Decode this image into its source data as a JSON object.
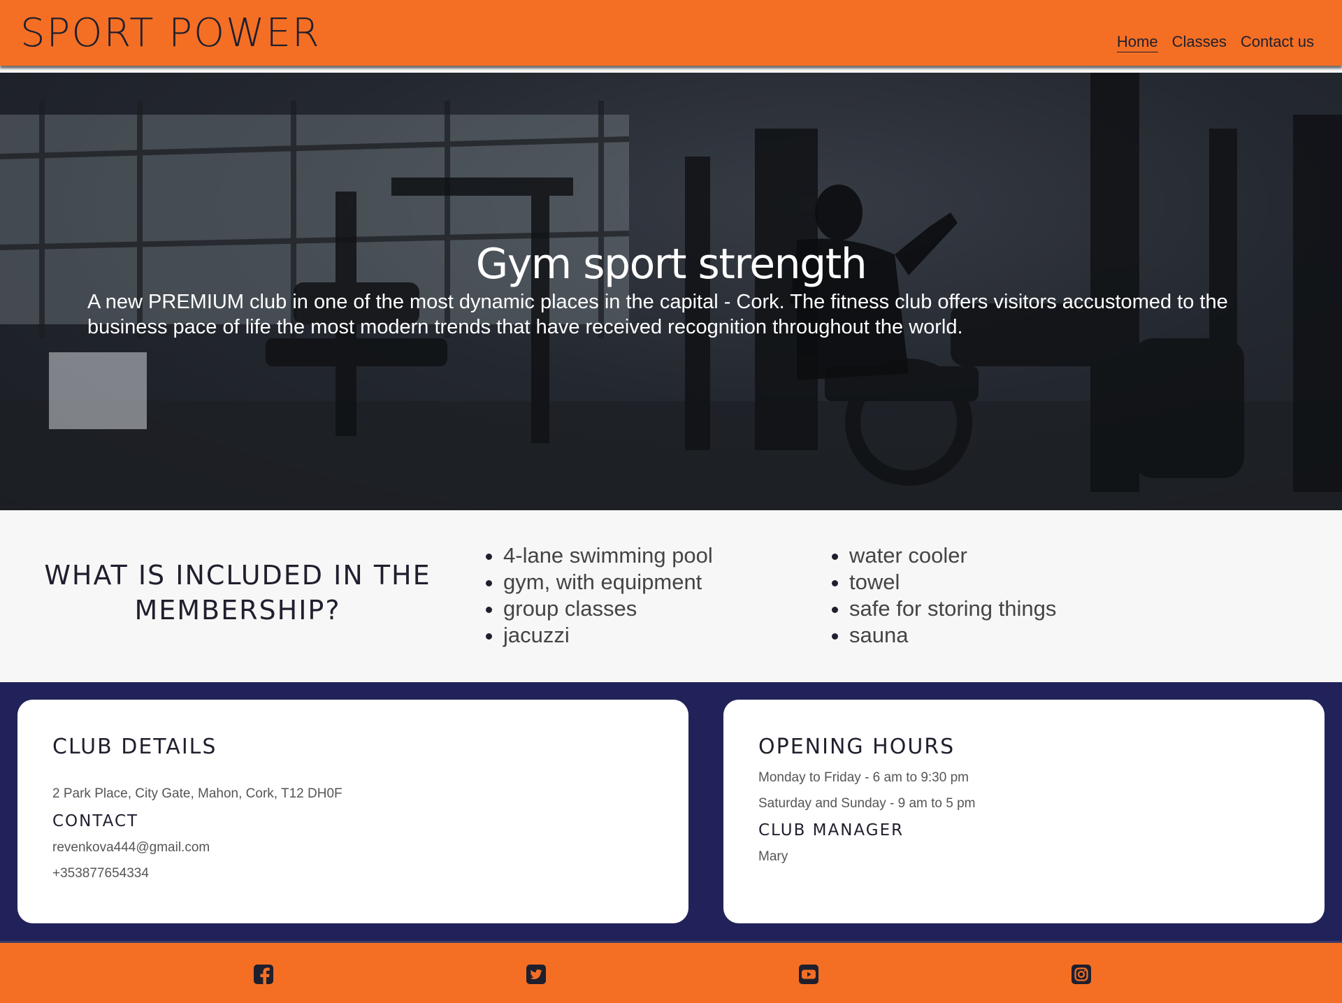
{
  "header": {
    "brand": "SPORT POWER",
    "nav": [
      {
        "label": "Home",
        "active": true
      },
      {
        "label": "Classes",
        "active": false
      },
      {
        "label": "Contact us",
        "active": false
      }
    ]
  },
  "hero": {
    "title": "Gym sport strength",
    "text": "A new PREMIUM club in one of the most dynamic places in the capital - Cork. The fitness club offers visitors accustomed to the business pace of life the most modern trends that have received recognition throughout the world."
  },
  "membership": {
    "heading": "WHAT IS INCLUDED IN THE MEMBERSHIP?",
    "left_items": [
      "4-lane swimming pool",
      "gym, with equipment",
      "group classes",
      "jacuzzi"
    ],
    "right_items": [
      "water cooler",
      "towel",
      "safe for storing things",
      "sauna"
    ]
  },
  "club_details": {
    "heading": "CLUB DETAILS",
    "address": "2 Park Place, City Gate, Mahon, Cork, T12 DH0F",
    "contact_heading": "CONTACT",
    "email": "revenkova444@gmail.com",
    "phone": "+353877654334"
  },
  "opening_hours": {
    "heading": "OPENING HOURS",
    "weekdays": "Monday to Friday - 6 am to 9:30 pm",
    "weekend": "Saturday and Sunday - 9 am to 5 pm",
    "manager_heading": "CLUB MANAGER",
    "manager": "Mary"
  },
  "footer": {
    "social_icons": [
      "facebook-icon",
      "twitter-icon",
      "youtube-icon",
      "instagram-icon"
    ]
  },
  "colors": {
    "brand_orange": "#f46f24",
    "navy": "#22225a",
    "dark_text": "#1f1f2e"
  }
}
